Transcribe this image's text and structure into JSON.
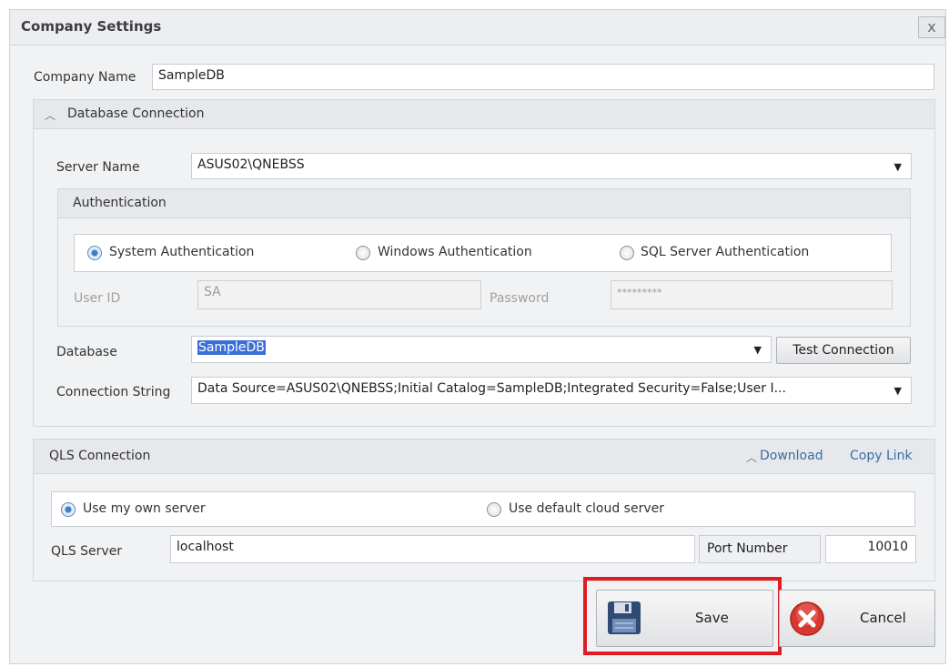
{
  "window": {
    "title": "Company Settings",
    "close": "x"
  },
  "company": {
    "label": "Company Name",
    "value": "SampleDB"
  },
  "db_section": {
    "title": "Database Connection",
    "server_label": "Server Name",
    "server_value": "ASUS02\\QNEBSS",
    "auth": {
      "title": "Authentication",
      "options": [
        "System Authentication",
        "Windows Authentication",
        "SQL Server Authentication"
      ],
      "selected": "System Authentication",
      "user_label": "User ID",
      "user_value": "SA",
      "password_label": "Password",
      "password_value": "*********"
    },
    "database_label": "Database",
    "database_value": "SampleDB",
    "test_button": "Test Connection",
    "connstr_label": "Connection String",
    "connstr_value": "Data Source=ASUS02\\QNEBSS;Initial Catalog=SampleDB;Integrated Security=False;User I..."
  },
  "qls_section": {
    "title": "QLS Connection",
    "download": "Download",
    "copy_link": "Copy Link",
    "options": [
      "Use my own server",
      "Use default cloud server"
    ],
    "selected": "Use my own server",
    "server_label": "QLS Server",
    "server_value": "localhost",
    "port_label": "Port Number",
    "port_value": "10010"
  },
  "footer": {
    "save": "Save",
    "cancel": "Cancel",
    "highlight_color": "#e11b22"
  }
}
